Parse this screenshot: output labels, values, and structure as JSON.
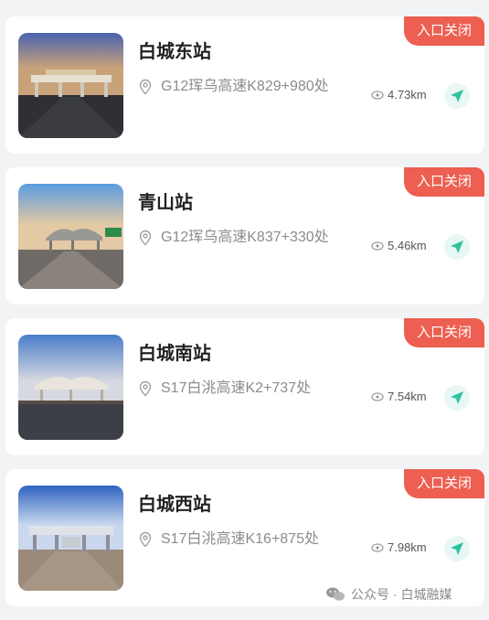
{
  "stations": [
    {
      "name": "白城东站",
      "location": "G12珲乌高速K829+980处",
      "distance": "4.73km",
      "status": "入口关闭",
      "sky_top": "#4a63b0",
      "sky_bottom": "#c9a27a"
    },
    {
      "name": "青山站",
      "location": "G12珲乌高速K837+330处",
      "distance": "5.46km",
      "status": "入口关闭",
      "sky_top": "#5b9de0",
      "sky_bottom": "#e4c9a5"
    },
    {
      "name": "白城南站",
      "location": "S17白洮高速K2+737处",
      "distance": "7.54km",
      "status": "入口关闭",
      "sky_top": "#4a7cc9",
      "sky_bottom": "#d7d9e0"
    },
    {
      "name": "白城西站",
      "location": "S17白洮高速K16+875处",
      "distance": "7.98km",
      "status": "入口关闭",
      "sky_top": "#2f63c0",
      "sky_bottom": "#c9d8ee"
    }
  ],
  "watermark": "公众号 · 白城融媒",
  "colors": {
    "tag": "#ec5f51",
    "nav": "#2ec2a0"
  }
}
